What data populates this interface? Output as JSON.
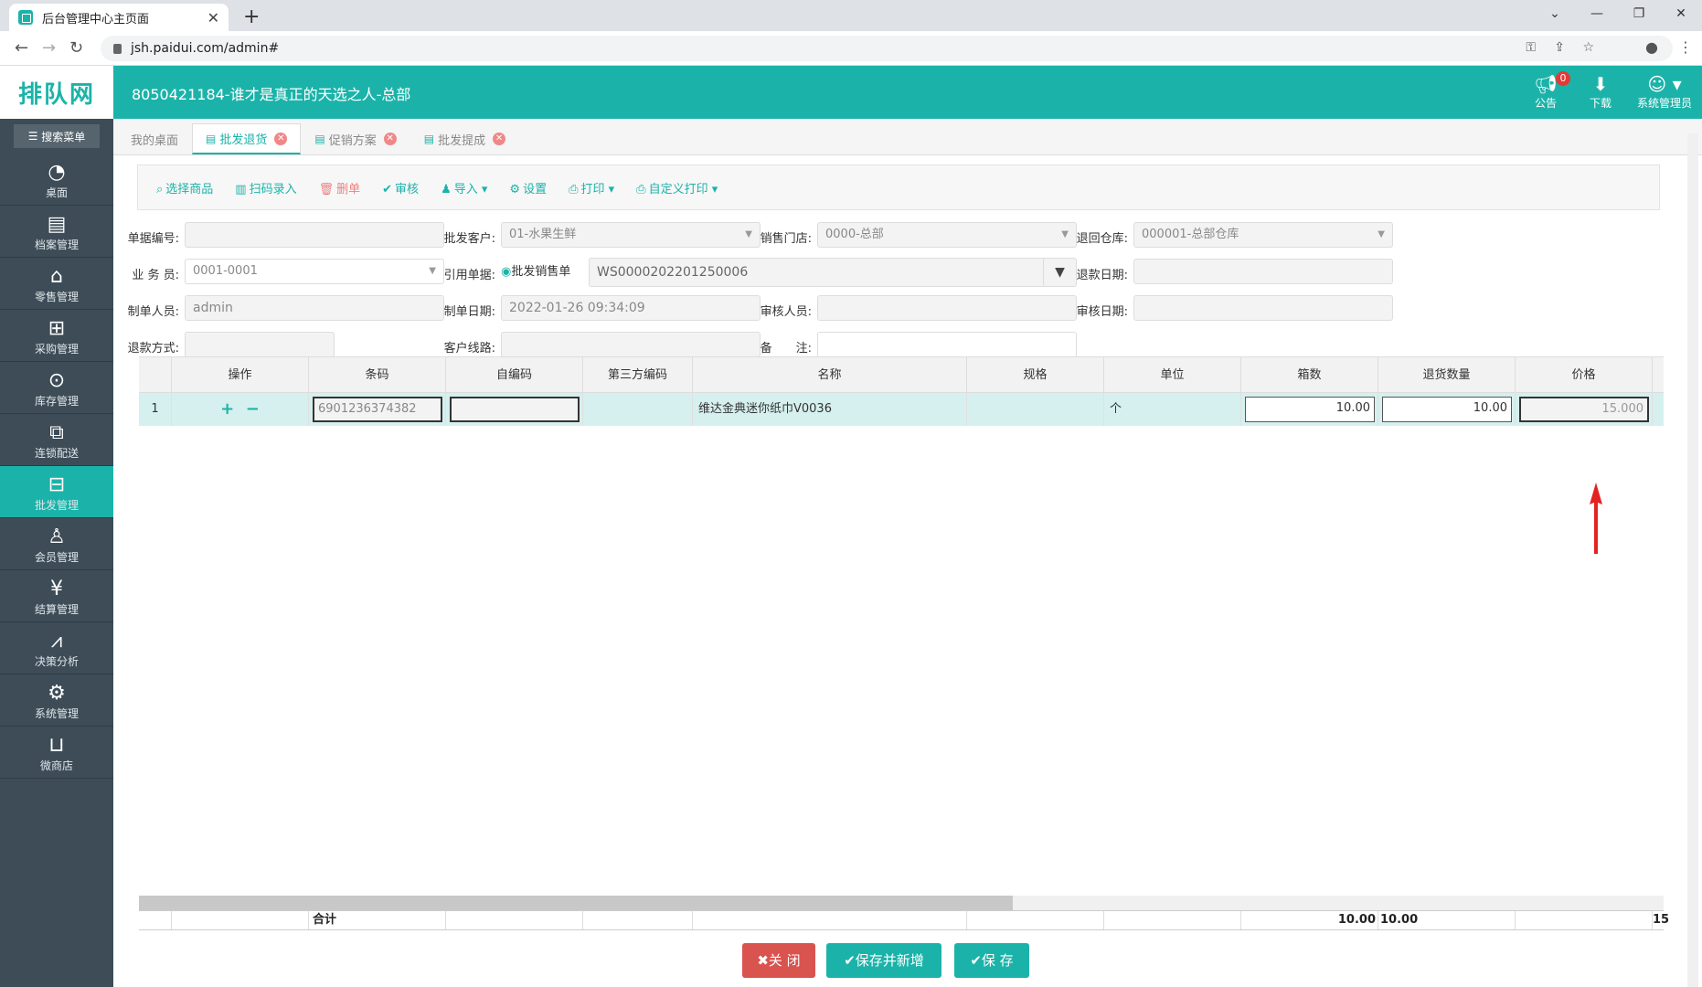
{
  "browser": {
    "tab_title": "后台管理中心主页面",
    "url": "jsh.paidui.com/admin#"
  },
  "header": {
    "logo_text": "排队网",
    "title": "8050421184-谁才是真正的天选之人-总部",
    "notice_label": "公告",
    "notice_count": "0",
    "download_label": "下载",
    "user_label": "系统管理员"
  },
  "sidebar": {
    "search_label": "搜索菜单",
    "items": [
      {
        "label": "桌面",
        "icon": "dashboard-icon"
      },
      {
        "label": "档案管理",
        "icon": "archive-icon"
      },
      {
        "label": "零售管理",
        "icon": "store-icon"
      },
      {
        "label": "采购管理",
        "icon": "purchase-icon"
      },
      {
        "label": "库存管理",
        "icon": "inventory-icon"
      },
      {
        "label": "连锁配送",
        "icon": "delivery-icon"
      },
      {
        "label": "批发管理",
        "icon": "wholesale-icon"
      },
      {
        "label": "会员管理",
        "icon": "member-icon"
      },
      {
        "label": "结算管理",
        "icon": "settlement-icon"
      },
      {
        "label": "决策分析",
        "icon": "analysis-icon"
      },
      {
        "label": "系统管理",
        "icon": "settings-icon"
      },
      {
        "label": "微商店",
        "icon": "microstore-icon"
      }
    ],
    "active_index": 6
  },
  "tabs": [
    {
      "label": "我的桌面",
      "closable": false,
      "active": false
    },
    {
      "label": "批发退货",
      "closable": true,
      "active": true
    },
    {
      "label": "促销方案",
      "closable": true,
      "active": false
    },
    {
      "label": "批发提成",
      "closable": true,
      "active": false
    }
  ],
  "toolbar": {
    "select_goods": "选择商品",
    "scan_entry": "扫码录入",
    "delete_doc": "删单",
    "approve": "审核",
    "import": "导入",
    "settings": "设置",
    "print": "打印",
    "custom_print": "自定义打印"
  },
  "form": {
    "doc_no_label": "单据编号:",
    "doc_no_value": "",
    "customer_label": "批发客户:",
    "customer_value": "01-水果生鲜",
    "store_label": "销售门店:",
    "store_value": "0000-总部",
    "warehouse_label": "退回仓库:",
    "warehouse_value": "000001-总部仓库",
    "salesman_label": "业 务 员:",
    "salesman_value": "0001-0001",
    "ref_label": "引用单据:",
    "ref_radio_label": "批发销售单",
    "ref_value": "WS0000202201250006",
    "refund_date_label": "退款日期:",
    "refund_date_value": "",
    "creator_label": "制单人员:",
    "creator_value": "admin",
    "create_date_label": "制单日期:",
    "create_date_value": "2022-01-26 09:34:09",
    "auditor_label": "审核人员:",
    "auditor_value": "",
    "audit_date_label": "审核日期:",
    "audit_date_value": "",
    "refund_method_label": "退款方式:",
    "refund_method_value": "",
    "route_label": "客户线路:",
    "route_value": "",
    "remark_label": "备　　注:",
    "remark_value": ""
  },
  "grid": {
    "columns": [
      "操作",
      "条码",
      "自编码",
      "第三方编码",
      "名称",
      "规格",
      "单位",
      "箱数",
      "退货数量",
      "价格"
    ],
    "rows": [
      {
        "index": "1",
        "barcode": "6901236374382",
        "self_code": "",
        "third_code": "",
        "name": "维达金典迷你纸巾V0036",
        "spec": "",
        "unit": "个",
        "boxes": "10.00",
        "return_qty": "10.00",
        "price": "15.000"
      }
    ],
    "footer": {
      "label": "合计",
      "boxes_total": "10.00",
      "qty_total": "10.00",
      "price_total": "15"
    }
  },
  "buttons": {
    "close": "关 闭",
    "save_new": "保存并新增",
    "save": "保 存"
  },
  "colors": {
    "brand": "#1bb3a9",
    "danger": "#d9534f",
    "sidebar": "#3d4c57"
  }
}
